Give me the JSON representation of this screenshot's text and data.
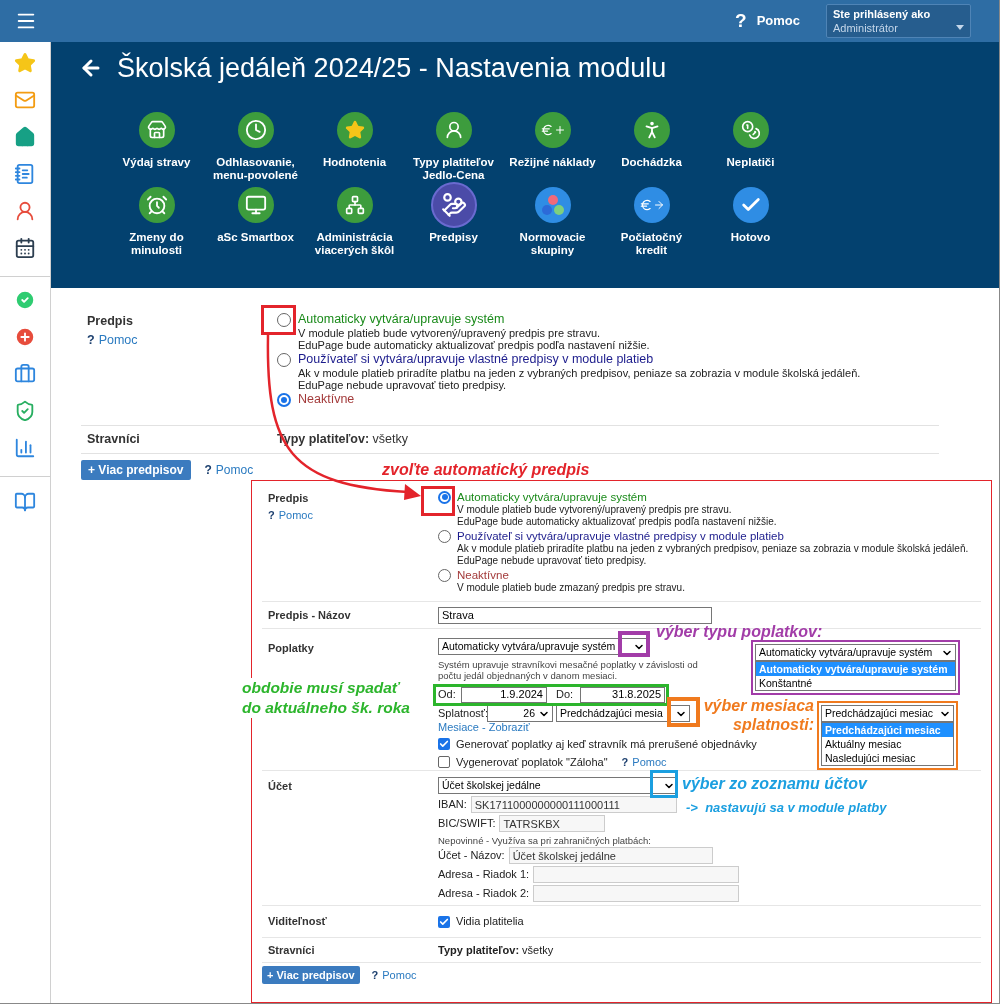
{
  "top_bar": {
    "help": {
      "mark": "?",
      "label": "Pomoc"
    },
    "user_label": "Ste prihlásený ako",
    "user_name": "Administrátor"
  },
  "page_title": "Školská jedáleň 2024/25 - Nastavenia modulu",
  "modules": [
    {
      "label": "Výdaj stravy",
      "color": "#3d9c3d",
      "selected": false
    },
    {
      "label": "Odhlasovanie, menu-povolené",
      "color": "#3d9c3d",
      "selected": false
    },
    {
      "label": "Hodnotenia",
      "color": "#3d9c3d",
      "selected": false
    },
    {
      "label": "Typy platiteľov Jedlo-Cena",
      "color": "#3d9c3d",
      "selected": false
    },
    {
      "label": "Režijné náklady",
      "color": "#3d9c3d",
      "selected": false
    },
    {
      "label": "Dochádzka",
      "color": "#3d9c3d",
      "selected": false
    },
    {
      "label": "Neplatiči",
      "color": "#3d9c3d",
      "selected": false
    },
    {
      "label": "Zmeny do minulosti",
      "color": "#3d9c3d",
      "selected": false
    },
    {
      "label": "aSc Smartbox",
      "color": "#3d9c3d",
      "selected": false
    },
    {
      "label": "Administrácia viacerých škôl",
      "color": "#3d9c3d",
      "selected": false
    },
    {
      "label": "Predpisy",
      "color": "#4b4ba8",
      "selected": true
    },
    {
      "label": "Normovacie skupiny",
      "color": "#2f8de4",
      "selected": false
    },
    {
      "label": "Počiatočný kredit",
      "color": "#2f8de4",
      "selected": false
    },
    {
      "label": "Hotovo",
      "color": "#2f8de4",
      "selected": false
    }
  ],
  "predpis": {
    "label": "Predpis",
    "help": {
      "mark": "?",
      "label": "Pomoc"
    },
    "options": [
      {
        "label": "Automaticky vytvára/upravuje systém",
        "color": "#1a8a1a",
        "selected": false,
        "description": [
          "V module platieb bude vytvorený/upravený predpis pre stravu.",
          "EduPage bude automaticky aktualizovať predpis podľa nastavení nižšie."
        ]
      },
      {
        "label": "Používateľ si vytvára/upravuje vlastné predpisy v module platieb",
        "color": "#1c1c8c",
        "selected": false,
        "description": [
          "Ak v module platieb priradíte platbu na jeden z vybraných predpisov, peniaze sa zobrazia v module školská jedáleň.",
          "EduPage nebude upravovať tieto predpisy."
        ]
      },
      {
        "label": "Neaktívne",
        "color": "#a33a3a",
        "selected": true
      }
    ]
  },
  "payer_row": {
    "label": "Stravníci",
    "value": "**Typy platiteľov:** všetky"
  },
  "more_button": "+ Viac predpisov",
  "help": {
    "mark": "?",
    "label": "Pomoc"
  },
  "panel": {
    "predpis": {
      "label": "Predpis",
      "help": {
        "mark": "?",
        "label": "Pomoc"
      },
      "options": [
        {
          "label": "Automaticky vytvára/upravuje systém",
          "color": "#1a8a1a",
          "selected": true,
          "description": [
            "V module platieb bude vytvorený/upravený predpis pre stravu.",
            "EduPage bude automaticky aktualizovať predpis podľa nastavení nižšie."
          ]
        },
        {
          "label": "Používateľ si vytvára/upravuje vlastné predpisy v module platieb",
          "color": "#1c1c8c",
          "selected": false,
          "description": [
            "Ak v module platieb priradíte platbu na jeden z vybraných predpisov, peniaze sa zobrazia v module školská jedáleň.",
            "EduPage nebude upravovať tieto predpisy."
          ]
        },
        {
          "label": "Neaktívne",
          "color": "#a33a3a",
          "selected": false,
          "description": [
            "V module platieb bude zmazaný predpis pre stravu."
          ]
        }
      ]
    },
    "name": {
      "label": "Predpis - Názov",
      "value": "Strava"
    },
    "fees": {
      "label": "Poplatky",
      "select": "Automaticky vytvára/upravuje systém",
      "note": "Systém upravuje stravníkovi mesačné poplatky v závislosti od počtu jedál objednaných v danom mesiaci.",
      "from_label": "Od:",
      "from": "1.9.2024",
      "to_label": "Do:",
      "to": "31.8.2025",
      "due_label": "Splatnosť:",
      "due_day": "26",
      "due_month": "Predchádzajúci mesia",
      "months_link": "Mesiace - Zobraziť",
      "checkboxes": [
        {
          "label": "Generovať poplatky aj keď stravník má prerušené objednávky",
          "checked": true
        },
        {
          "label": "Vygenerovať poplatok \"Záloha\"",
          "checked": false
        }
      ],
      "help": {
        "mark": "?",
        "label": "Pomoc"
      }
    },
    "account": {
      "label": "Účet",
      "select": "Účet školskej jedálne",
      "iban_label": "IBAN:",
      "iban": "SK1711000000000111000111",
      "bic_label": "BIC/SWIFT:",
      "bic": "TATRSKBX",
      "optional_note": "Nepovinné - Využíva sa pri zahraničných platbách:",
      "name_label": "Účet - Názov:",
      "name": "Účet školskej jedálne",
      "address1_label": "Adresa - Riadok 1:",
      "address2_label": "Adresa - Riadok 2:"
    },
    "visibility": {
      "label": "Viditeľnosť",
      "checkbox": {
        "label": "Vidia platitelia",
        "checked": true
      }
    },
    "payer_row": {
      "label": "Stravníci",
      "value": "**Typy platiteľov:** všetky"
    },
    "more_button": "+ Viac predpisov",
    "help": {
      "mark": "?",
      "label": "Pomoc"
    }
  },
  "annotations": [
    {
      "text": "zvoľte automatický predpis",
      "color": "#e3242b"
    },
    {
      "text": "výber typu poplatkov:",
      "color": "#a23ca8"
    },
    {
      "text": "obdobie musí spadať do aktuálneho šk. roka",
      "color": "#2cb52c"
    },
    {
      "text": "výber mesiaca splatnosti:",
      "color": "#f07a1e"
    },
    {
      "text": "výber zo zoznamu účtov",
      "color": "#1b9fe0"
    },
    {
      "text": "->  nastavujú sa v module platby",
      "color": "#1b9fe0"
    }
  ],
  "fee_type_menu": {
    "value": "Automaticky vytvára/upravuje systém",
    "options": [
      {
        "label": "Automaticky vytvára/upravuje systém",
        "selected": true
      },
      {
        "label": "Konštantné",
        "selected": false
      }
    ]
  },
  "due_month_menu": {
    "value": "Predchádzajúci mesiac",
    "options": [
      {
        "label": "Predchádzajúci mesiac",
        "selected": true
      },
      {
        "label": "Aktuálny mesiac",
        "selected": false
      },
      {
        "label": "Nasledujúci mesiac",
        "selected": false
      }
    ]
  }
}
